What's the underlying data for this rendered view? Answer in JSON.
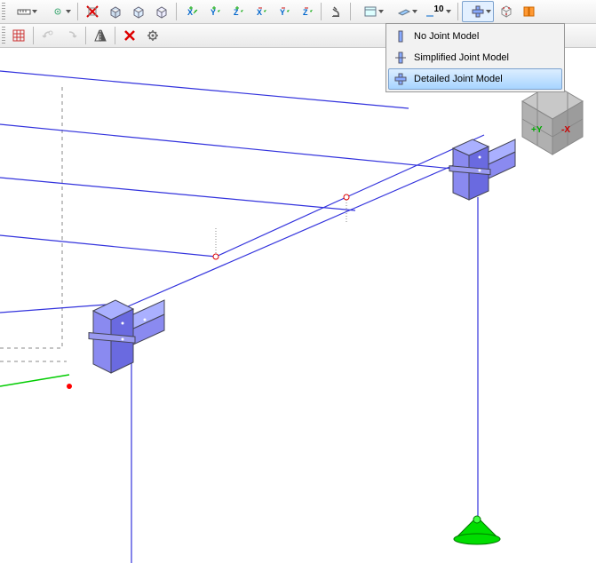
{
  "toolbar1": {
    "btn_ruler": "ruler",
    "btn_tool2": "tool",
    "btn_hide": "hide-red",
    "btn_box1": "box",
    "btn_box2": "box",
    "btn_box3": "box",
    "btn_x": "+x",
    "btn_y": "+y",
    "btn_z": "+z",
    "btn_nx": "-x",
    "btn_ny": "-y",
    "btn_nz": "-z",
    "btn_micro": "micro",
    "btn_win": "window",
    "btn_plane": "plane",
    "btn_10": "10",
    "btn_joint": "joint-model",
    "btn_grid": "grid3d",
    "btn_orange": "panel"
  },
  "toolbar2": {
    "btn_red": "red-grid",
    "btn_a": "a",
    "btn_b": "b",
    "btn_mirror": "mirror",
    "btn_x": "delete",
    "btn_gear": "settings"
  },
  "menu": {
    "items": [
      {
        "label": "No Joint Model",
        "selected": false
      },
      {
        "label": "Simplified Joint Model",
        "selected": false
      },
      {
        "label": "Detailed Joint Model",
        "selected": true
      }
    ]
  },
  "axis_cube": {
    "y": "+Y",
    "x": "-X"
  }
}
